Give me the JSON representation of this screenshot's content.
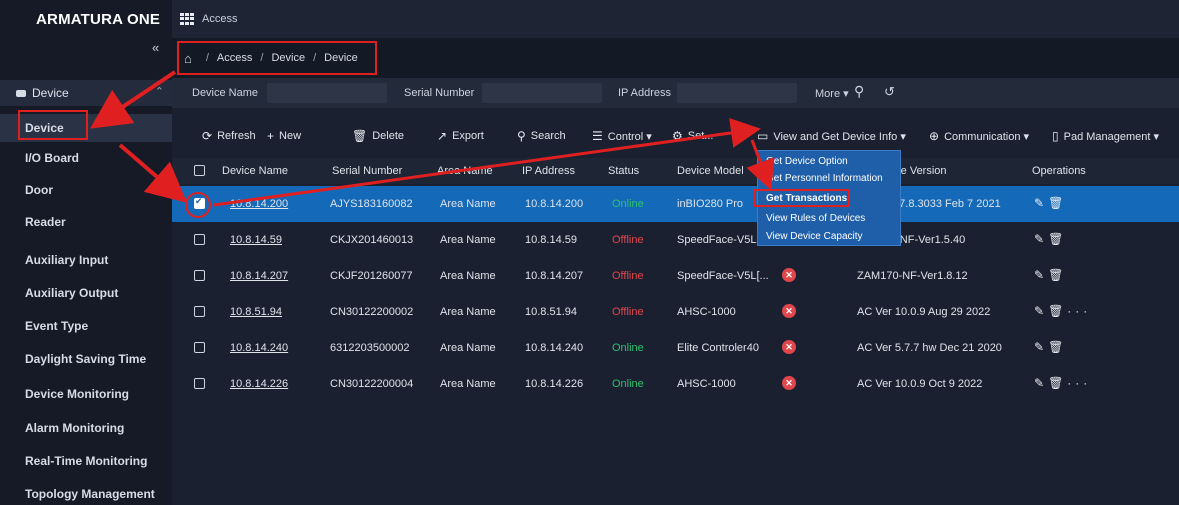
{
  "app": {
    "logo": "ARMATURA ONE",
    "module": "Access"
  },
  "breadcrumb": {
    "home": "⌂",
    "items": [
      "Access",
      "Device",
      "Device"
    ],
    "separator": "/"
  },
  "sidebar": {
    "collapse": "«",
    "group": "Device",
    "items": [
      "Device",
      "I/O Board",
      "Door",
      "Reader",
      "Auxiliary Input",
      "Auxiliary Output",
      "Event Type",
      "Daylight Saving Time",
      "Device Monitoring",
      "Alarm Monitoring",
      "Real-Time Monitoring",
      "Topology Management"
    ]
  },
  "filters": {
    "device_name": "Device Name",
    "serial_number": "Serial Number",
    "ip_address": "IP Address",
    "more": "More ▾"
  },
  "toolbar": {
    "refresh": "Refresh",
    "new": "New",
    "delete": "Delete",
    "export": "Export",
    "search": "Search",
    "control": "Control ▾",
    "setup": "Set...",
    "view_info": "View and Get Device Info ▾",
    "communication": "Communication ▾",
    "pad": "Pad Management ▾"
  },
  "table": {
    "headers": [
      "Device Name",
      "Serial Number",
      "Area Name",
      "IP Address",
      "Status",
      "Device Model",
      "re Version",
      "Operations"
    ],
    "rows": [
      {
        "name": "10.8.14.200",
        "serial": "AJYS183160082",
        "area": "Area Name",
        "ip": "10.8.14.200",
        "status": "Online",
        "model": "inBIO280 Pro",
        "firmware": "5.7.8.3033 Feb 7 2021",
        "selected": true,
        "more": false
      },
      {
        "name": "10.8.14.59",
        "serial": "CKJX201460013",
        "area": "Area Name",
        "ip": "10.8.14.59",
        "status": "Offline",
        "model": "SpeedFace-V5L",
        "firmware": "0-NF-Ver1.5.40",
        "selected": false,
        "more": false
      },
      {
        "name": "10.8.14.207",
        "serial": "CKJF201260077",
        "area": "Area Name",
        "ip": "10.8.14.207",
        "status": "Offline",
        "model": "SpeedFace-V5L[...",
        "firmware": "ZAM170-NF-Ver1.8.12",
        "selected": false,
        "more": false
      },
      {
        "name": "10.8.51.94",
        "serial": "CN30122200002",
        "area": "Area Name",
        "ip": "10.8.51.94",
        "status": "Offline",
        "model": "AHSC-1000",
        "firmware": "AC Ver 10.0.9 Aug 29 2022",
        "selected": false,
        "more": true
      },
      {
        "name": "10.8.14.240",
        "serial": "6312203500002",
        "area": "Area Name",
        "ip": "10.8.14.240",
        "status": "Online",
        "model": "Elite Controler40",
        "firmware": "AC Ver 5.7.7 hw Dec 21 2020",
        "selected": false,
        "more": false
      },
      {
        "name": "10.8.14.226",
        "serial": "CN30122200004",
        "area": "Area Name",
        "ip": "10.8.14.226",
        "status": "Online",
        "model": "AHSC-1000",
        "firmware": "AC Ver 10.0.9 Oct 9 2022",
        "selected": false,
        "more": true
      }
    ]
  },
  "dropdown": {
    "items": [
      "Get Device Option",
      "Get Personnel Information",
      "Get Transactions",
      "View Rules of Devices",
      "View Device Capacity"
    ]
  },
  "ops": {
    "edit": "✎",
    "delete": "🗑",
    "more": "···"
  }
}
